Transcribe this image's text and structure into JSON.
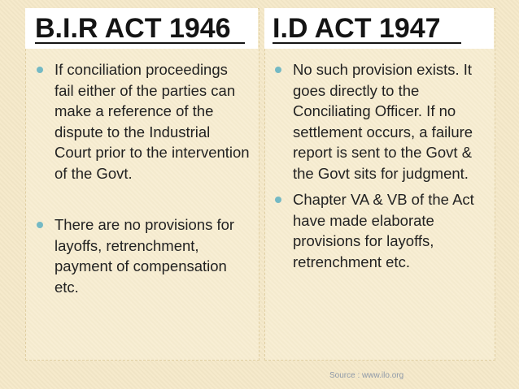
{
  "left": {
    "title": "B.I.R  ACT 1946",
    "bullets": [
      "If conciliation proceedings fail either of the parties can make a reference of the dispute to the Industrial Court prior to the intervention of the Govt.",
      "There are no provisions for layoffs, retrenchment, payment of compensation etc."
    ]
  },
  "right": {
    "title": "I.D  ACT 1947",
    "bullets": [
      "No such provision exists. It goes directly to the Conciliating Officer. If no settlement occurs, a failure report is sent to the Govt & the Govt sits for judgment.",
      "Chapter VA & VB of the Act have made elaborate provisions for layoffs, retrenchment etc."
    ]
  },
  "footer": {
    "source": "Source : www.ilo.org"
  },
  "colors": {
    "background": "#f5e9c9",
    "bullet": "#74b9c4",
    "header_bg": "#ffffff",
    "text": "#222222"
  }
}
